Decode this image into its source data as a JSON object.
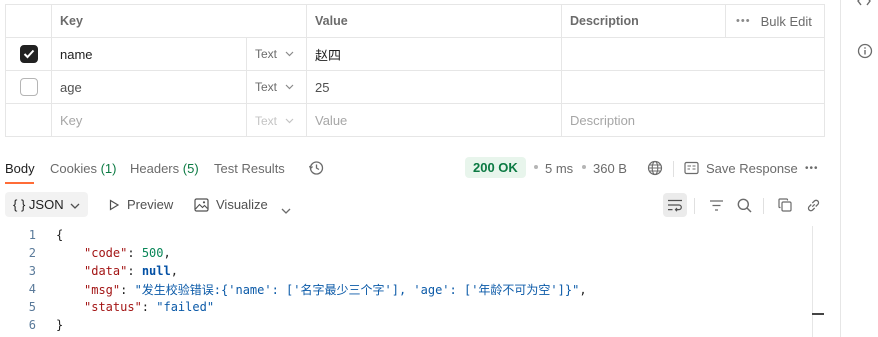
{
  "params": {
    "headers": {
      "key": "Key",
      "value": "Value",
      "description": "Description",
      "bulk_edit": "Bulk Edit"
    },
    "rows": [
      {
        "checked": true,
        "key": "name",
        "type": "Text",
        "value": "赵四"
      },
      {
        "checked": false,
        "key": "age",
        "type": "Text",
        "value": "25"
      }
    ],
    "placeholder": {
      "key": "Key",
      "type": "Text",
      "value": "Value",
      "description": "Description"
    }
  },
  "response": {
    "tabs": {
      "body": "Body",
      "cookies": "Cookies",
      "cookies_count": "(1)",
      "headers": "Headers",
      "headers_count": "(5)",
      "test_results": "Test Results"
    },
    "status": "200 OK",
    "time": "5 ms",
    "size": "360 B",
    "save_response": "Save Response"
  },
  "format": {
    "json_label": "{ } JSON",
    "preview": "Preview",
    "visualize": "Visualize"
  },
  "code": {
    "line_numbers": [
      "1",
      "2",
      "3",
      "4",
      "5",
      "6"
    ],
    "open_brace": "{",
    "close_brace": "}",
    "code_key": "\"code\"",
    "code_val": "500",
    "data_key": "\"data\"",
    "data_val": "null",
    "msg_key": "\"msg\"",
    "msg_val": "\"发生校验错误:{'name': ['名字最少三个字'], 'age': ['年龄不可为空']}\"",
    "status_key": "\"status\"",
    "status_val": "\"failed\""
  },
  "colors": {
    "accent": "#ff6c37",
    "success": "#0c7a43",
    "success_bg": "#e8f5ec"
  }
}
